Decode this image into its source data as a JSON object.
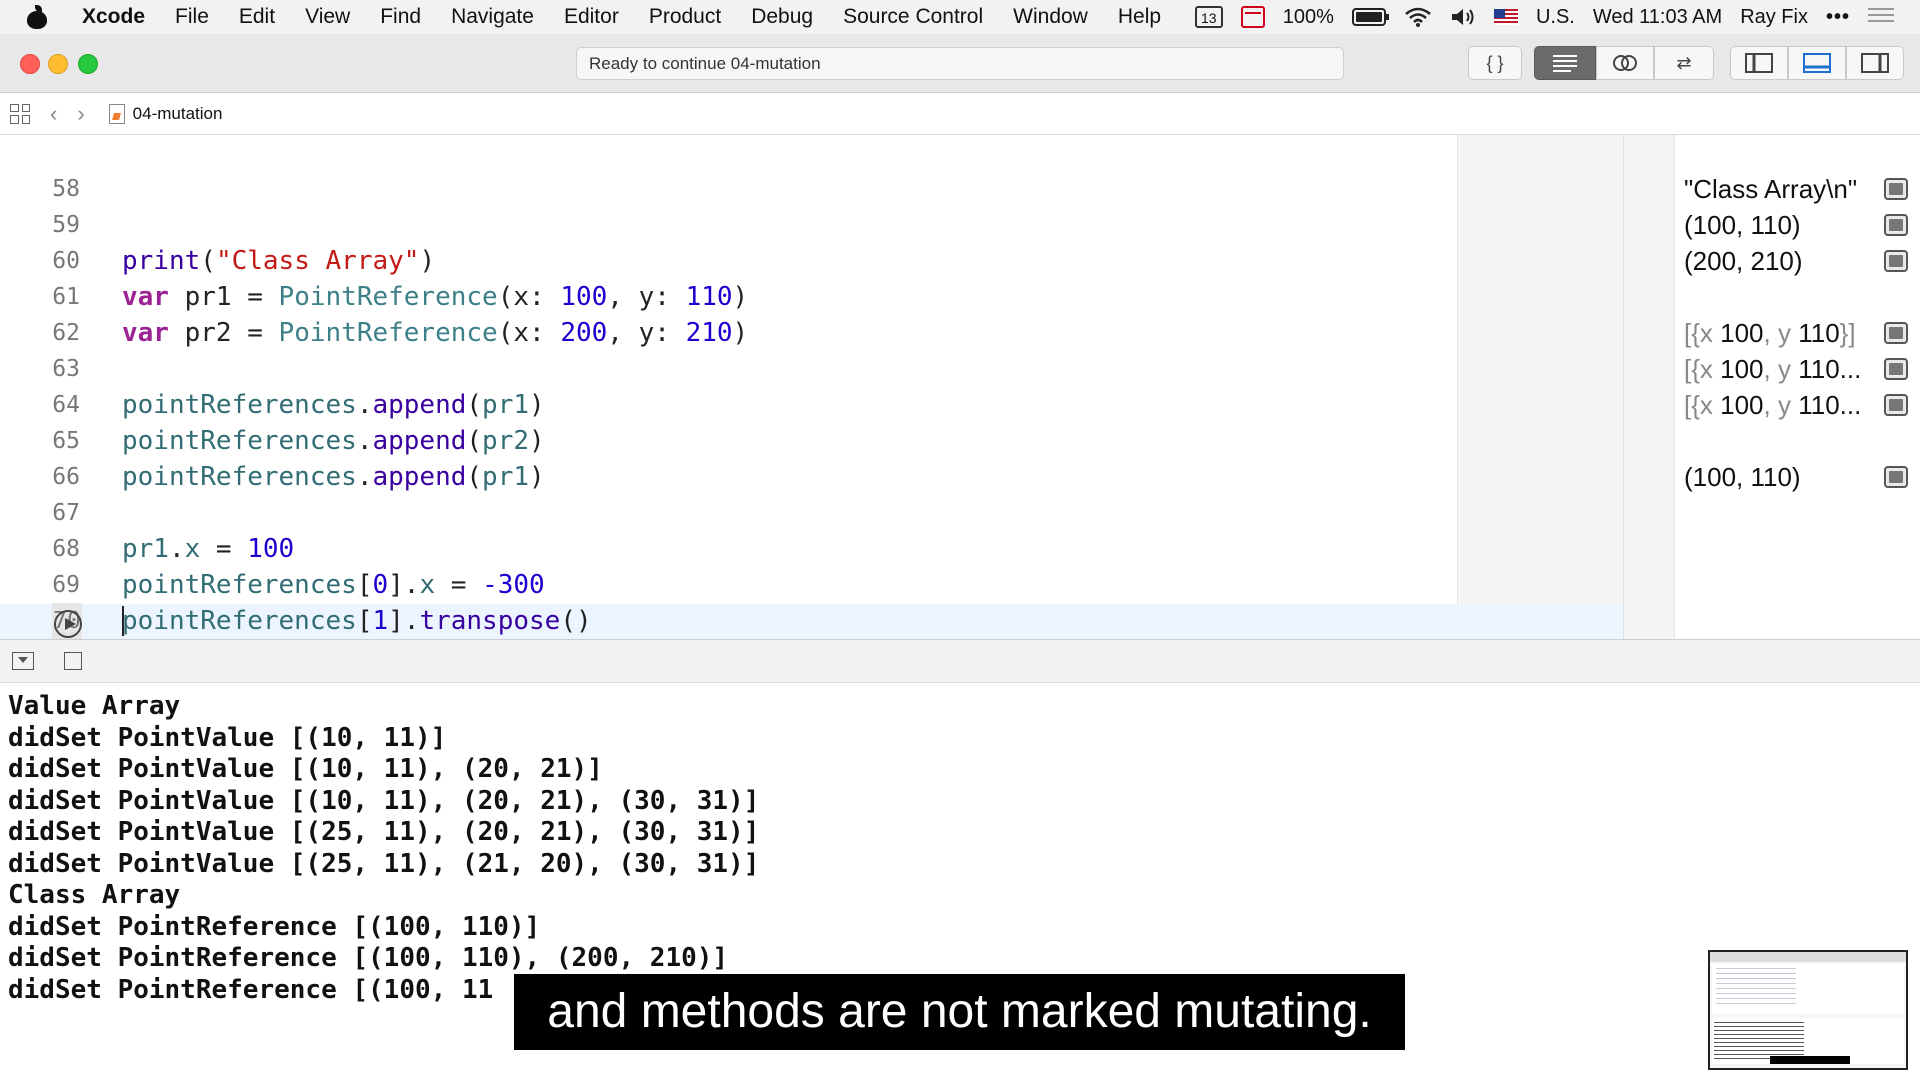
{
  "menubar": {
    "app": "Xcode",
    "items": [
      "File",
      "Edit",
      "View",
      "Find",
      "Navigate",
      "Editor",
      "Product",
      "Debug",
      "Source Control",
      "Window",
      "Help"
    ],
    "calendar_day": "13",
    "battery": "100%",
    "input_source": "U.S.",
    "clock": "Wed 11:03 AM",
    "user": "Ray Fix",
    "more": "•••"
  },
  "toolbar": {
    "status": "Ready to continue 04-mutation",
    "code_review_glyph": "{ }",
    "editor_swap_glyph": "⇄"
  },
  "jumpbar": {
    "file": "04-mutation",
    "back_glyph": "‹",
    "forward_glyph": "›"
  },
  "editor": {
    "lines": [
      {
        "n": "58"
      },
      {
        "n": "59"
      },
      {
        "n": "60"
      },
      {
        "n": "61"
      },
      {
        "n": "62"
      },
      {
        "n": "63"
      },
      {
        "n": "64"
      },
      {
        "n": "65"
      },
      {
        "n": "66"
      },
      {
        "n": "67"
      },
      {
        "n": "68"
      },
      {
        "n": "69"
      },
      {
        "n": "70"
      }
    ],
    "code": {
      "l59": [
        "print",
        "(",
        "\"Class Array\"",
        ")"
      ],
      "l60": [
        "var",
        " pr1 = ",
        "PointReference",
        "(x: ",
        "100",
        ", y: ",
        "110",
        ")"
      ],
      "l61": [
        "var",
        " pr2 = ",
        "PointReference",
        "(x: ",
        "200",
        ", y: ",
        "210",
        ")"
      ],
      "l63": [
        "pointReferences",
        ".",
        "append",
        "(",
        "pr1",
        ")"
      ],
      "l64": [
        "pointReferences",
        ".",
        "append",
        "(",
        "pr2",
        ")"
      ],
      "l65": [
        "pointReferences",
        ".",
        "append",
        "(",
        "pr1",
        ")"
      ],
      "l67": [
        "pr1",
        ".",
        "x",
        " = ",
        "100"
      ],
      "l68": [
        "pointReferences",
        "[",
        "0",
        "].",
        "x",
        " = ",
        "-300"
      ],
      "l69": [
        "pointReferences",
        "[",
        "1",
        "].",
        "transpose",
        "()"
      ]
    }
  },
  "results": {
    "r59": "\"Class Array\\n\"",
    "r60": "(100, 110)",
    "r61": "(200, 210)",
    "r63": {
      "open": "[{x ",
      "a": "100",
      "sep": ", y ",
      "b": "110",
      "close": "}]"
    },
    "r64": {
      "open": "[{x ",
      "a": "100",
      "sep": ", y ",
      "b": "110",
      "close": "..."
    },
    "r65": {
      "open": "[{x ",
      "a": "100",
      "sep": ", y ",
      "b": "110",
      "close": "..."
    },
    "r67": "(100, 110)"
  },
  "console": {
    "lines": [
      "Value Array",
      "didSet PointValue [(10, 11)]",
      "didSet PointValue [(10, 11), (20, 21)]",
      "didSet PointValue [(10, 11), (20, 21), (30, 31)]",
      "didSet PointValue [(25, 11), (20, 21), (30, 31)]",
      "didSet PointValue [(25, 11), (21, 20), (30, 31)]",
      "Class Array",
      "didSet PointReference [(100, 110)]",
      "didSet PointReference [(100, 110), (200, 210)]",
      "didSet PointReference [(100, 11"
    ]
  },
  "caption": "and methods are not marked mutating.",
  "colors": {
    "keyword": "#9b2393",
    "string": "#c41a16",
    "number": "#1c00cf",
    "type": "#3e8087",
    "function": "#3900a0",
    "current_line": "#ecf5ff"
  }
}
